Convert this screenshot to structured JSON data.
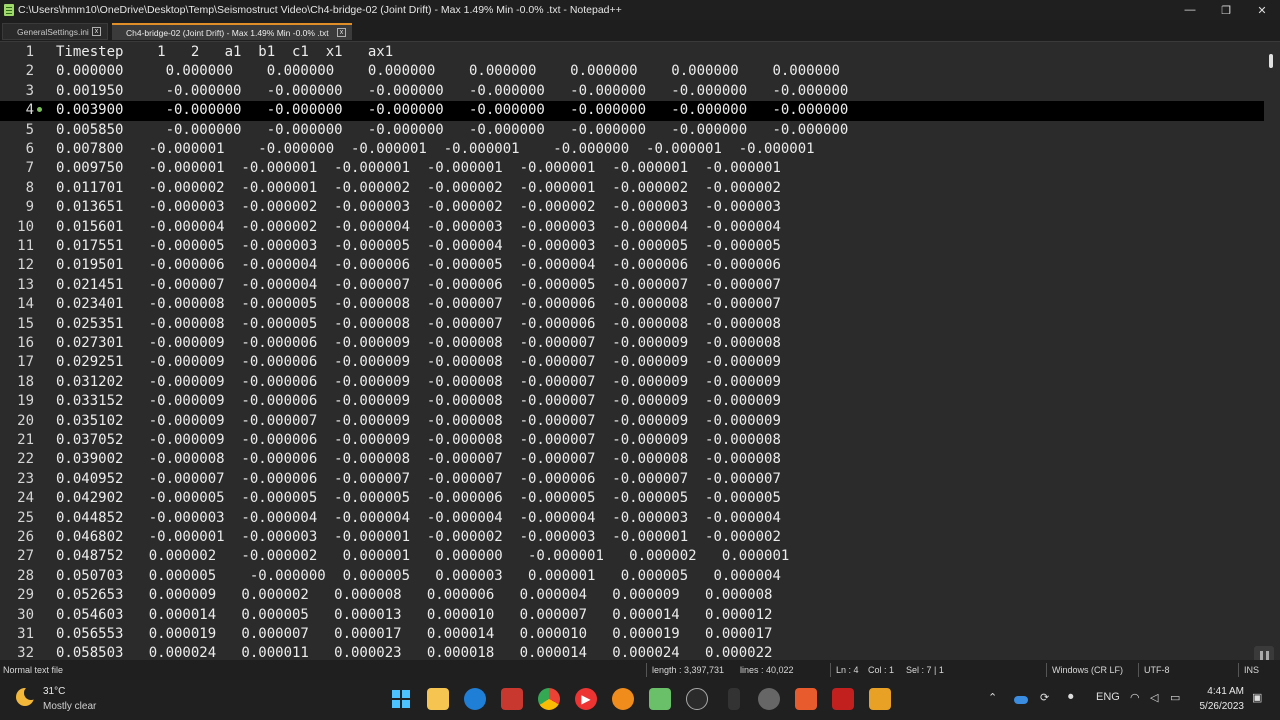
{
  "window": {
    "title": "C:\\Users\\hmm10\\OneDrive\\Desktop\\Temp\\Seismostruct Video\\Ch4-bridge-02 (Joint Drift) -  Max 1.49% Min -0.0% .txt - Notepad++",
    "minimize_glyph": "—",
    "restore_glyph": "❐",
    "close_glyph": "✕"
  },
  "tabs": [
    {
      "label": "GeneralSettings.ini",
      "close": "x"
    },
    {
      "label": "Ch4-bridge-02 (Joint Drift) -  Max 1.49% Min -0.0% .txt",
      "close": "x"
    }
  ],
  "editor": {
    "current_line": 4,
    "lines": [
      {
        "n": "1",
        "text": "Timestep    1   2   a1  b1  c1  x1   ax1"
      },
      {
        "n": "2",
        "text": "0.000000     0.000000    0.000000    0.000000    0.000000    0.000000    0.000000    0.000000"
      },
      {
        "n": "3",
        "text": "0.001950     -0.000000   -0.000000   -0.000000   -0.000000   -0.000000   -0.000000   -0.000000"
      },
      {
        "n": "4",
        "text": "0.003900     -0.000000   -0.000000   -0.000000   -0.000000   -0.000000   -0.000000   -0.000000"
      },
      {
        "n": "5",
        "text": "0.005850     -0.000000   -0.000000   -0.000000   -0.000000   -0.000000   -0.000000   -0.000000"
      },
      {
        "n": "6",
        "text": "0.007800   -0.000001    -0.000000  -0.000001  -0.000001    -0.000000  -0.000001  -0.000001"
      },
      {
        "n": "7",
        "text": "0.009750   -0.000001  -0.000001  -0.000001  -0.000001  -0.000001  -0.000001  -0.000001"
      },
      {
        "n": "8",
        "text": "0.011701   -0.000002  -0.000001  -0.000002  -0.000002  -0.000001  -0.000002  -0.000002"
      },
      {
        "n": "9",
        "text": "0.013651   -0.000003  -0.000002  -0.000003  -0.000002  -0.000002  -0.000003  -0.000003"
      },
      {
        "n": "10",
        "text": "0.015601   -0.000004  -0.000002  -0.000004  -0.000003  -0.000003  -0.000004  -0.000004"
      },
      {
        "n": "11",
        "text": "0.017551   -0.000005  -0.000003  -0.000005  -0.000004  -0.000003  -0.000005  -0.000005"
      },
      {
        "n": "12",
        "text": "0.019501   -0.000006  -0.000004  -0.000006  -0.000005  -0.000004  -0.000006  -0.000006"
      },
      {
        "n": "13",
        "text": "0.021451   -0.000007  -0.000004  -0.000007  -0.000006  -0.000005  -0.000007  -0.000007"
      },
      {
        "n": "14",
        "text": "0.023401   -0.000008  -0.000005  -0.000008  -0.000007  -0.000006  -0.000008  -0.000007"
      },
      {
        "n": "15",
        "text": "0.025351   -0.000008  -0.000005  -0.000008  -0.000007  -0.000006  -0.000008  -0.000008"
      },
      {
        "n": "16",
        "text": "0.027301   -0.000009  -0.000006  -0.000009  -0.000008  -0.000007  -0.000009  -0.000008"
      },
      {
        "n": "17",
        "text": "0.029251   -0.000009  -0.000006  -0.000009  -0.000008  -0.000007  -0.000009  -0.000009"
      },
      {
        "n": "18",
        "text": "0.031202   -0.000009  -0.000006  -0.000009  -0.000008  -0.000007  -0.000009  -0.000009"
      },
      {
        "n": "19",
        "text": "0.033152   -0.000009  -0.000006  -0.000009  -0.000008  -0.000007  -0.000009  -0.000009"
      },
      {
        "n": "20",
        "text": "0.035102   -0.000009  -0.000007  -0.000009  -0.000008  -0.000007  -0.000009  -0.000009"
      },
      {
        "n": "21",
        "text": "0.037052   -0.000009  -0.000006  -0.000009  -0.000008  -0.000007  -0.000009  -0.000008"
      },
      {
        "n": "22",
        "text": "0.039002   -0.000008  -0.000006  -0.000008  -0.000007  -0.000007  -0.000008  -0.000008"
      },
      {
        "n": "23",
        "text": "0.040952   -0.000007  -0.000006  -0.000007  -0.000007  -0.000006  -0.000007  -0.000007"
      },
      {
        "n": "24",
        "text": "0.042902   -0.000005  -0.000005  -0.000005  -0.000006  -0.000005  -0.000005  -0.000005"
      },
      {
        "n": "25",
        "text": "0.044852   -0.000003  -0.000004  -0.000004  -0.000004  -0.000004  -0.000003  -0.000004"
      },
      {
        "n": "26",
        "text": "0.046802   -0.000001  -0.000003  -0.000001  -0.000002  -0.000003  -0.000001  -0.000002"
      },
      {
        "n": "27",
        "text": "0.048752   0.000002   -0.000002   0.000001   0.000000   -0.000001   0.000002   0.000001"
      },
      {
        "n": "28",
        "text": "0.050703   0.000005    -0.000000  0.000005   0.000003   0.000001   0.000005   0.000004"
      },
      {
        "n": "29",
        "text": "0.052653   0.000009   0.000002   0.000008   0.000006   0.000004   0.000009   0.000008"
      },
      {
        "n": "30",
        "text": "0.054603   0.000014   0.000005   0.000013   0.000010   0.000007   0.000014   0.000012"
      },
      {
        "n": "31",
        "text": "0.056553   0.000019   0.000007   0.000017   0.000014   0.000010   0.000019   0.000017"
      },
      {
        "n": "32",
        "text": "0.058503   0.000024   0.000011   0.000023   0.000018   0.000014   0.000024   0.000022"
      }
    ]
  },
  "statusbar": {
    "filetype": "Normal text file",
    "length": "length : 3,397,731",
    "lines": "lines : 40,022",
    "ln": "Ln : 4",
    "col": "Col : 1",
    "sel": "Sel : 7 | 1",
    "eol": "Windows (CR LF)",
    "encoding": "UTF-8",
    "mode": "INS"
  },
  "taskbar": {
    "temperature": "31°C",
    "weather": "Mostly clear",
    "language": "ENG",
    "time": "4:41 AM",
    "date": "5/26/2023",
    "apps": [
      "windows-start",
      "file-explorer",
      "edge",
      "pdf",
      "chrome",
      "media-player",
      "search",
      "whatsapp",
      "phone",
      "settings",
      "sublime",
      "red-app",
      "notepad-plus"
    ]
  },
  "colors": {
    "editor_bg": "#2b2b2b",
    "current_line_bg": "#000000",
    "text": "#ececec",
    "tab_accent": "#e08f28"
  }
}
